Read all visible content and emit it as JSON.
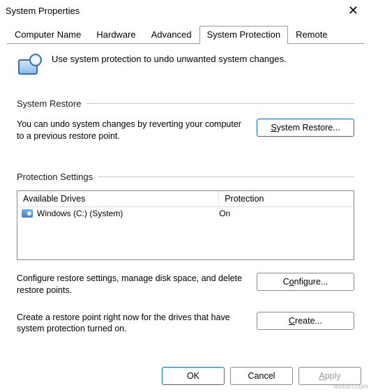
{
  "window": {
    "title": "System Properties"
  },
  "tabs": [
    {
      "label": "Computer Name"
    },
    {
      "label": "Hardware"
    },
    {
      "label": "Advanced"
    },
    {
      "label": "System Protection"
    },
    {
      "label": "Remote"
    }
  ],
  "intro_text": "Use system protection to undo unwanted system changes.",
  "section_restore": {
    "title": "System Restore",
    "text": "You can undo system changes by reverting your computer to a previous restore point.",
    "button": "System Restore..."
  },
  "section_settings": {
    "title": "Protection Settings",
    "headers": {
      "drives": "Available Drives",
      "protection": "Protection"
    },
    "rows": [
      {
        "drive": "Windows (C:) (System)",
        "protection": "On"
      }
    ],
    "configure_text": "Configure restore settings, manage disk space, and delete restore points.",
    "configure_button": "Configure...",
    "create_text": "Create a restore point right now for the drives that have system protection turned on.",
    "create_button": "Create..."
  },
  "footer": {
    "ok": "OK",
    "cancel": "Cancel",
    "apply": "Apply"
  },
  "watermark": "wsxdn.com"
}
